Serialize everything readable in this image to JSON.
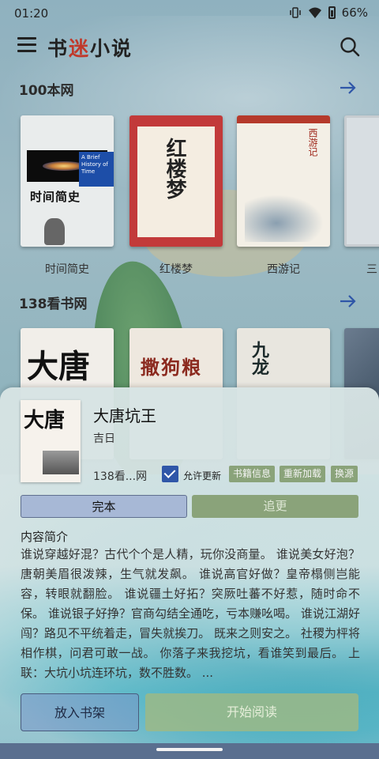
{
  "status_bar": {
    "time": "01:20",
    "battery": "66%"
  },
  "app": {
    "title_part1": "书",
    "title_accent": "迷",
    "title_part2": "小说"
  },
  "sections": [
    {
      "title": "100本网",
      "books": [
        {
          "label": "时间简史",
          "cover_title": "时间简史",
          "cover_en": "A Brief History of Time"
        },
        {
          "label": "红楼梦",
          "cover_title": "红楼梦"
        },
        {
          "label": "西游记",
          "cover_title": "西游记"
        },
        {
          "label": "三"
        }
      ]
    },
    {
      "title": "138看书网",
      "books": [
        {
          "cover_title": "大唐"
        },
        {
          "cover_title": "撒狗粮"
        },
        {
          "cover_title": "九龙"
        },
        {
          "cover_title": ""
        }
      ]
    }
  ],
  "detail": {
    "title": "大唐坑王",
    "author": "吉日",
    "source": "138看...网",
    "allow_update": "允许更新",
    "chip_info": "书籍信息",
    "chip_reload": "重新加载",
    "chip_switch": "换源",
    "btn_complete": "完本",
    "btn_follow": "追更",
    "intro_title": "内容简介",
    "intro_text": "谁说穿越好混？古代个个是人精，玩你没商量。 谁说美女好泡？唐朝美眉很泼辣，生气就发飙。 谁说高官好做？皇帝榻侧岂能容，转眼就翻脸。 谁说疆土好拓？突厥吐蕃不好惹，随时命不保。 谁说银子好挣？官商勾结全通吃，亏本赚吆喝。 谁说江湖好闯？路见不平统着走，冒失就挨刀。 既来之则安之。 社稷为枰将相作棋，问君可敢一战。 你落子来我挖坑，看谁笑到最后。 上联：大坑小坑连环坑，数不胜数。 ...",
    "btn_shelf": "放入书架",
    "btn_read": "开始阅读"
  },
  "colors": {
    "accent_green": "#8aa37a",
    "accent_blue": "#2f56a8",
    "title_red": "#c0392b"
  }
}
